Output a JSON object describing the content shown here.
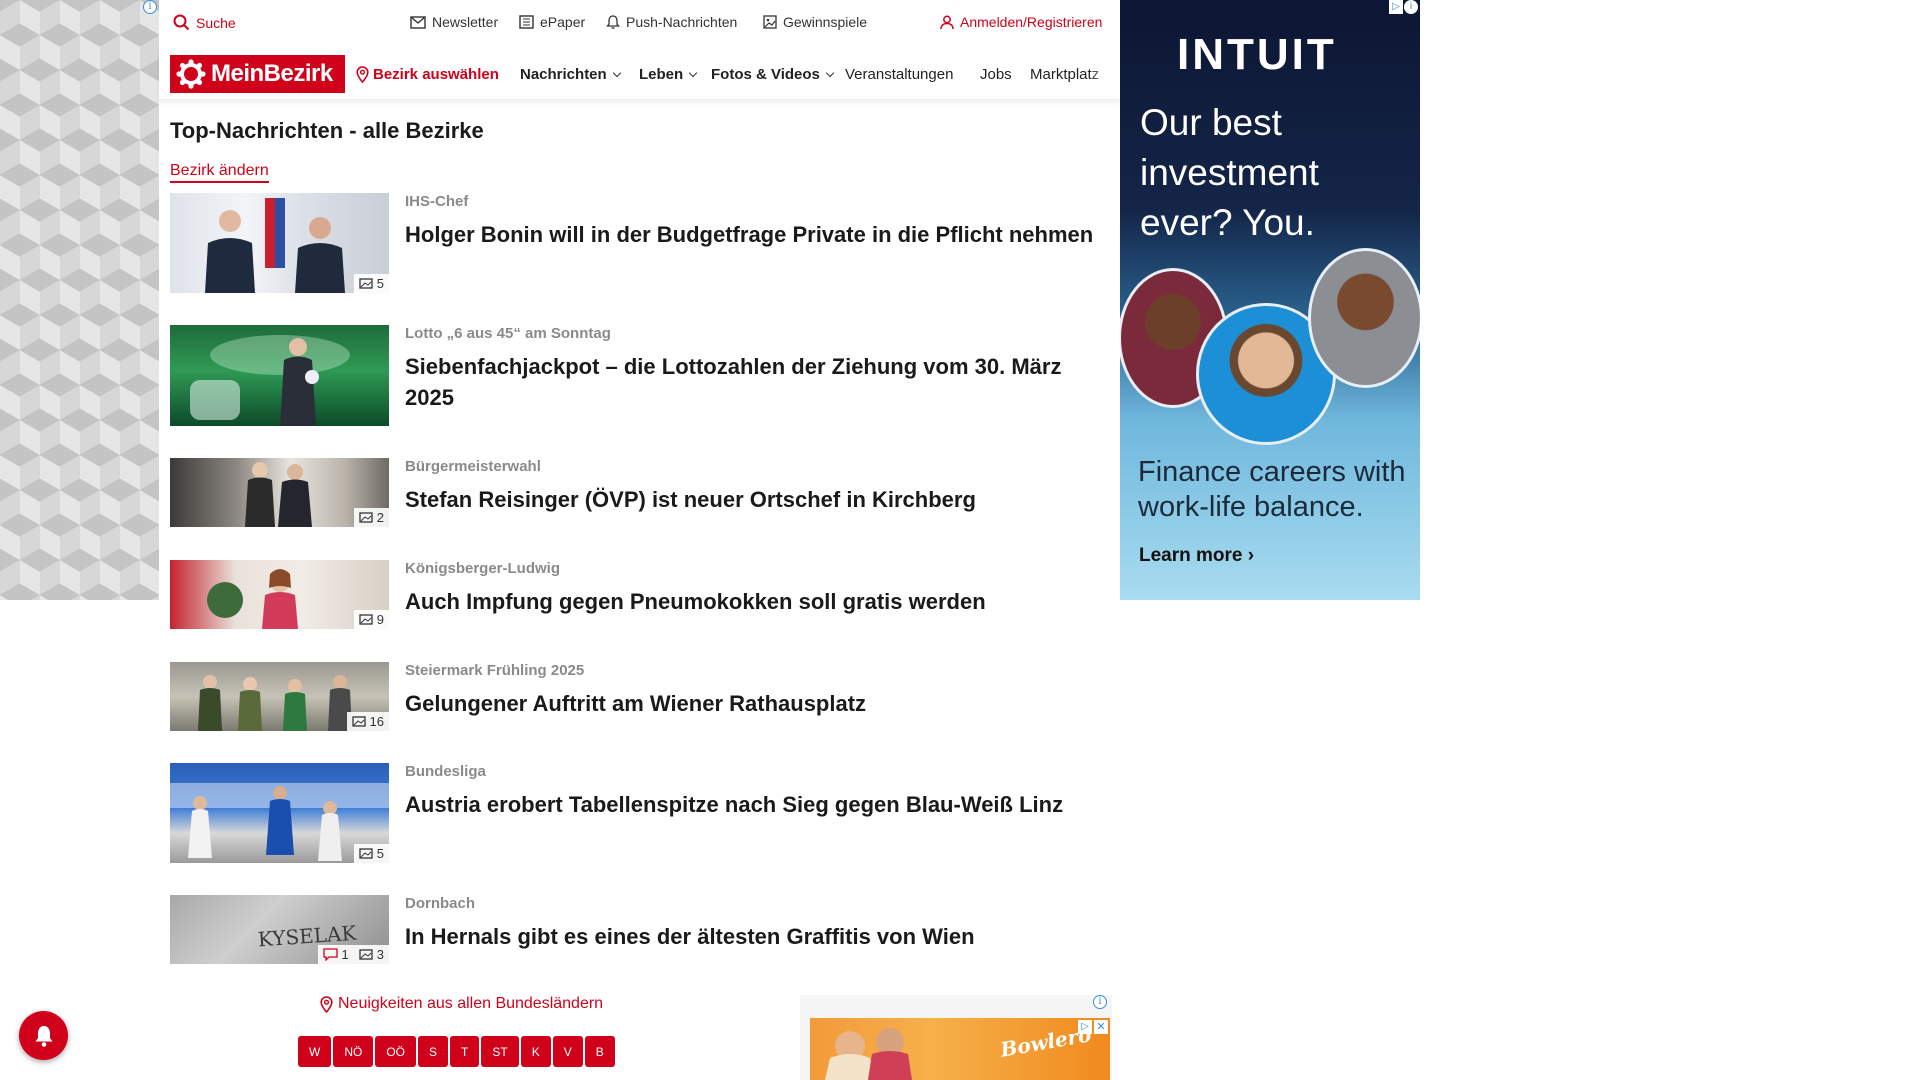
{
  "utility_bar": {
    "search": "Suche",
    "newsletter": "Newsletter",
    "epaper": "ePaper",
    "push": "Push-Nachrichten",
    "games": "Gewinnspiele",
    "login": "Anmelden/Registrieren"
  },
  "nav": {
    "logo": "MeinBezirk",
    "district_select": "Bezirk auswählen",
    "items": [
      "Nachrichten",
      "Leben",
      "Fotos & Videos",
      "Veranstaltungen",
      "Jobs",
      "Marktplatz"
    ]
  },
  "section": {
    "title": "Top-Nachrichten - alle Bezirke",
    "change_link": "Bezirk ändern"
  },
  "articles": [
    {
      "kicker": "IHS-Chef",
      "headline": "Holger Bonin will in der Budgetfrage Private in die Pflicht nehmen",
      "photos": "5",
      "comments": ""
    },
    {
      "kicker": "Lotto „6 aus 45“ am Sonntag",
      "headline": "Siebenfachjackpot – die Lottozahlen der Ziehung vom 30. März 2025",
      "photos": "",
      "comments": ""
    },
    {
      "kicker": "Bürgermeisterwahl",
      "headline": "Stefan Reisinger (ÖVP) ist neuer Ortschef in Kirchberg",
      "photos": "2",
      "comments": ""
    },
    {
      "kicker": "Königsberger-Ludwig",
      "headline": "Auch Impfung gegen Pneumokokken soll gratis werden",
      "photos": "9",
      "comments": ""
    },
    {
      "kicker": "Steiermark Frühling 2025",
      "headline": "Gelungener Auftritt am Wiener Rathausplatz",
      "photos": "16",
      "comments": ""
    },
    {
      "kicker": "Bundesliga",
      "headline": "Austria erobert Tabellenspitze nach Sieg gegen Blau-Weiß Linz",
      "photos": "5",
      "comments": ""
    },
    {
      "kicker": "Dornbach",
      "headline": "In Hernals gibt es eines der ältesten Graffitis von Wien",
      "photos": "3",
      "comments": "1"
    }
  ],
  "regions": {
    "link": "Neuigkeiten aus allen Bundesländern",
    "states": [
      "W",
      "NÖ",
      "OÖ",
      "S",
      "T",
      "ST",
      "K",
      "V",
      "B"
    ]
  },
  "ad_right": {
    "brand": "INTUIT",
    "tagline": "Our best investment ever? You.",
    "sub": "Finance careers with work-life balance.",
    "cta": "Learn more ›"
  },
  "ad_bottom": {
    "brand_text": "Bowlero"
  },
  "colors": {
    "brand_red": "#d0021b"
  }
}
